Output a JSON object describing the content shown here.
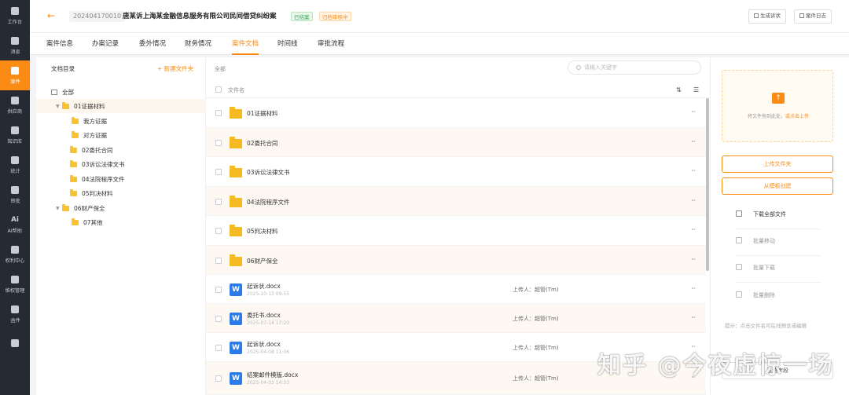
{
  "nav": {
    "items": [
      {
        "label": "工作台",
        "icon": "dashboard-icon",
        "active": false
      },
      {
        "label": "消息",
        "icon": "bell-icon",
        "active": false
      },
      {
        "label": "案件",
        "icon": "case-icon",
        "active": true
      },
      {
        "label": "供应商",
        "icon": "building-icon",
        "active": false
      },
      {
        "label": "知识库",
        "icon": "book-icon",
        "active": false
      },
      {
        "label": "统计",
        "icon": "bar-chart-icon",
        "active": false
      },
      {
        "label": "审批",
        "icon": "approval-icon",
        "active": false
      },
      {
        "label": "AI帮助",
        "icon": "ai-icon",
        "glyph": "Ai",
        "active": false
      },
      {
        "label": "权利中心",
        "icon": "rights-center-icon",
        "active": false
      },
      {
        "label": "维权管理",
        "icon": "shield-icon",
        "active": false
      },
      {
        "label": "函件",
        "icon": "letter-icon",
        "active": false
      },
      {
        "label": "",
        "icon": "more-icon",
        "active": false
      }
    ]
  },
  "header": {
    "back_icon": "back-arrow-icon",
    "case_no": "202404170010",
    "title": "唐某诉上海某金融信息服务有限公司民间借贷纠纷案",
    "status_closed": "已结案",
    "status_archive": "归档审核中",
    "btn_generate": "生成诉状",
    "btn_log": "案件日志"
  },
  "tabs": [
    "案件信息",
    "办案记录",
    "委外情况",
    "财务情况",
    "案件文档",
    "时间线",
    "审批流程"
  ],
  "active_tab": 4,
  "tree": {
    "title": "文档目录",
    "new_folder": "+ 新建文件夹",
    "root": "全部",
    "nodes": [
      {
        "label": "01证据材料",
        "expanded": true
      },
      {
        "label": "我方证据"
      },
      {
        "label": "对方证据"
      },
      {
        "label": "02委托合同"
      },
      {
        "label": "03诉讼法律文书"
      },
      {
        "label": "04法院程序文件"
      },
      {
        "label": "05判决材料"
      },
      {
        "label": "06财产保全",
        "expanded": true
      },
      {
        "label": "07其他"
      }
    ]
  },
  "files": {
    "breadcrumb": "全部",
    "search_placeholder": "请输入关键字",
    "col_name": "文件名",
    "rows": [
      {
        "name": "01证据材料",
        "type": "folder",
        "more": "···"
      },
      {
        "name": "02委托合同",
        "type": "folder",
        "more": "···"
      },
      {
        "name": "03诉讼法律文书",
        "type": "folder",
        "more": "···"
      },
      {
        "name": "04法院程序文件",
        "type": "folder",
        "more": "···"
      },
      {
        "name": "05判决材料",
        "type": "folder",
        "more": "···"
      },
      {
        "name": "06财产保全",
        "type": "folder",
        "more": "···"
      },
      {
        "name": "起诉状.docx",
        "type": "word",
        "date": "2025-10-13 09:55",
        "uploader": "上传人：超管(Tm)",
        "more": "···"
      },
      {
        "name": "委托书.docx",
        "type": "word",
        "date": "2025-07-14 17:20",
        "uploader": "上传人：超管(Tm)",
        "more": "···"
      },
      {
        "name": "起诉状.docx",
        "type": "word",
        "date": "2025-04-08 11:06",
        "uploader": "上传人：超管(Tm)",
        "more": "···"
      },
      {
        "name": "结案邮件模版.docx",
        "type": "word",
        "date": "2025-04-03 14:33",
        "uploader": "上传人：超管(Tm)",
        "more": "···"
      }
    ]
  },
  "actions": {
    "upload_hint": "将文件拖到此处，",
    "upload_link": "或点击上传",
    "upload_folder": "上传文件夹",
    "from_template": "从模板创建",
    "download_all": "下载全部文件",
    "batch_move": "批量移动",
    "batch_download": "批量下载",
    "batch_delete": "批量删除",
    "hint": "提示：点击文件名可在线预览或编辑",
    "system_field": "系统字段"
  },
  "brand_watermark": "知乎 @今夜虚惊一场",
  "colors": {
    "accent": "#fa8c16",
    "rail": "#252a33",
    "word": "#2b7ce9",
    "folder": "#f5b922"
  }
}
